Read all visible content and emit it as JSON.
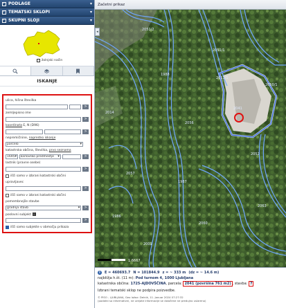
{
  "layers": [
    {
      "label": "PODLAGE"
    },
    {
      "label": "TEMATSKI SKLOPI"
    },
    {
      "label": "SKUPNI SLOJI"
    }
  ],
  "overview": {
    "option_label": "žolnjski način"
  },
  "panel": {
    "title": "ISKANJE"
  },
  "search": {
    "street_label": "ulica, hišna številka",
    "place_label": "zemljepisno ime",
    "coord_label_a": "koordinata",
    "coord_label_b": " E, N (D96)",
    "parcel_label_a": "nepremičnine, ",
    "parcel_label_b": "napredno iskanje",
    "parcel_type": "parcelo",
    "ko_label_a": "katastrska občina, številka, ",
    "ko_label_b": "prvo seznama",
    "ko_number": "1695",
    "ko_name": "karlovško predmestje",
    "owner_label": "lastnik (pravne osebe)",
    "only_in_view_1": "išči samo v izbrani katastrski občini",
    "manager_label": "upravljavec",
    "only_in_view_2": "išči samo v izbrani katastrski občini",
    "land_use_label": "pomembnejše stavbe",
    "land_use_value": "gradnja stavb",
    "subject_label": "poslovni subjekt",
    "subject_checkbox": "išči samo subjekte v območju prikaza",
    "go_label": ">"
  },
  "map": {
    "header": "Začetni prikaz",
    "parcel_labels": [
      "2041",
      "2051/2",
      "2051/1",
      "2052",
      "2056",
      "2057",
      "2060",
      "2063",
      "2014",
      "1988",
      "2001",
      "1986",
      "1987",
      "2011/1",
      "2050/1"
    ],
    "scale_label": "1:6667"
  },
  "status": {
    "e": "E = 460693.7",
    "n": "N = 101844.9",
    "z": "z = ~ 333 m",
    "dz": "(dz = ~ 14.6 m)",
    "nearest_prefix": "najbližja h.št. (11 m):",
    "nearest_address": "Pod turnom 4, 1000 Ljubljana",
    "ko_prefix": "katastrska občina:",
    "ko_value": "1725-AJDOVŠČINA",
    "parcel_prefix": ", parcela:",
    "parcel_value": "2041 (površina 761 m2)",
    "building_prefix": ", stavba:",
    "building_value": "7",
    "note": "Izbrani tematski sklop ne podpira poizvedbe.",
    "footer_1": "© PISO - LJUBLJANA, Geo ložaz: Delnik, 11. Januar 2024 07:27:32",
    "footer_2": "(podatki so informativni, ne urejate informacije se določene ne predujno uslareno)"
  },
  "colors": {
    "panel_header": "#2b4d7a",
    "highlight": "#dd1111",
    "parcel_line": "#6fa6ff"
  }
}
